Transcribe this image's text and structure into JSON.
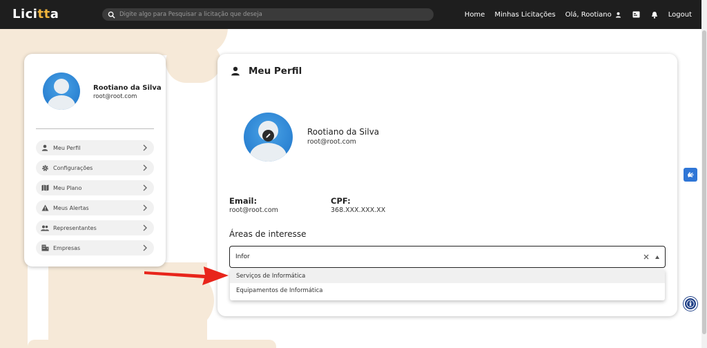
{
  "app": {
    "logo_prefix": "Lici",
    "logo_accent": "tt",
    "logo_suffix": "a"
  },
  "search": {
    "placeholder": "Digite algo para Pesquisar a licitação que deseja"
  },
  "nav": {
    "home": "Home",
    "minhas_licitacoes": "Minhas Licitações",
    "greeting": "Olá, Rootiano",
    "logout": "Logout"
  },
  "sidebar_card": {
    "name": "Rootiano da Silva",
    "email": "root@root.com",
    "items": [
      {
        "label": "Meu Perfil",
        "icon": "person-icon"
      },
      {
        "label": "Configurações",
        "icon": "gear-icon"
      },
      {
        "label": "Meu Plano",
        "icon": "map-icon"
      },
      {
        "label": "Meus Alertas",
        "icon": "warning-icon"
      },
      {
        "label": "Representantes",
        "icon": "group-icon"
      },
      {
        "label": "Empresas",
        "icon": "building-icon"
      }
    ]
  },
  "profile": {
    "title": "Meu Perfil",
    "name": "Rootiano da Silva",
    "email": "root@root.com",
    "email_label": "Email:",
    "email_value": "root@root.com",
    "cpf_label": "CPF:",
    "cpf_value": "368.XXX.XXX.XX",
    "areas_label": "Áreas de interesse",
    "areas_input_value": "Infor",
    "options": [
      "Serviços de Informática",
      "Equipamentos de Informática"
    ]
  },
  "colors": {
    "accent": "#f0b43c",
    "primary": "#1d73c9",
    "navbar": "#1e1e1e",
    "arrow": "#e8251b"
  }
}
